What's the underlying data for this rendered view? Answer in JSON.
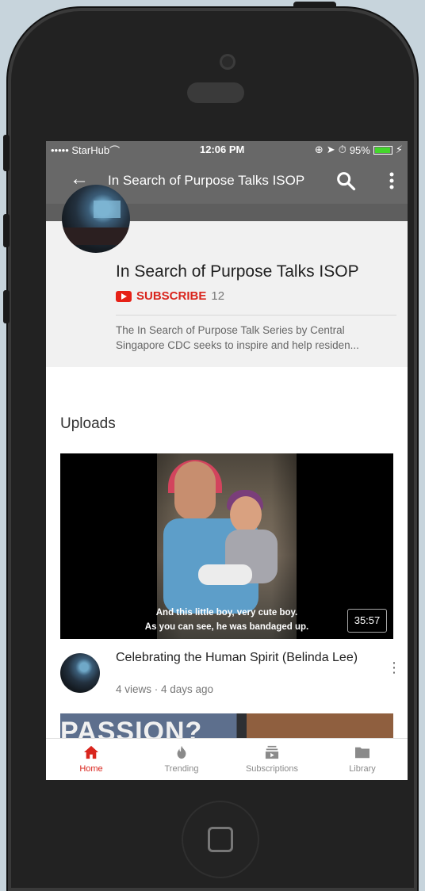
{
  "status_bar": {
    "carrier": "••••• StarHub ",
    "time": "12:06 PM",
    "battery": "95%",
    "wifi_icon": "wifi-icon"
  },
  "app_bar": {
    "title": "In Search of Purpose Talks ISOP",
    "back_icon": "back-arrow-icon",
    "search_icon": "search-icon",
    "more_icon": "more-vertical-icon"
  },
  "channel": {
    "name": "In Search of Purpose Talks ISOP",
    "subscribe_label": "SUBSCRIBE",
    "subscriber_count": "12",
    "description": "The In Search of Purpose Talk Series by Central Singapore CDC seeks to inspire and help residen..."
  },
  "uploads": {
    "title": "Uploads",
    "video": {
      "subtitle_line1": "And this little boy, very cute boy.",
      "subtitle_line2": "As you can see, he was bandaged up.",
      "duration": "35:57",
      "title": "Celebrating the Human Spirit (Belinda Lee)",
      "meta": "4 views · 4 days ago"
    },
    "next_thumb_text": "PASSION?"
  },
  "tabs": [
    {
      "label": "Home",
      "icon": "home-icon",
      "active": true
    },
    {
      "label": "Trending",
      "icon": "flame-icon",
      "active": false
    },
    {
      "label": "Subscriptions",
      "icon": "subscriptions-icon",
      "active": false
    },
    {
      "label": "Library",
      "icon": "folder-icon",
      "active": false
    }
  ],
  "colors": {
    "accent": "#d9251d",
    "header": "#686868",
    "channel_bg": "#f1f1f1"
  }
}
